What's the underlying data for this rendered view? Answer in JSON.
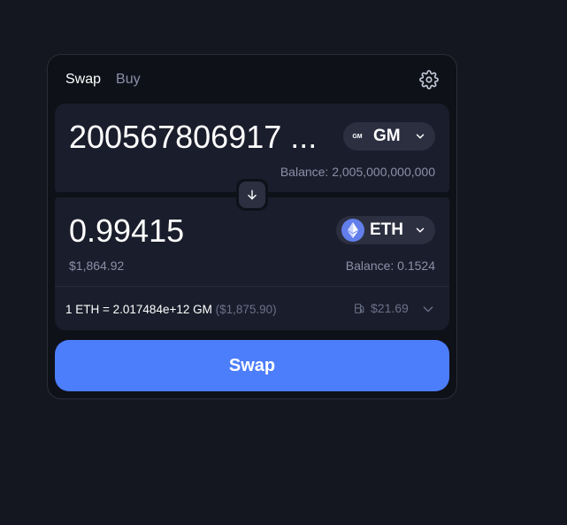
{
  "tabs": [
    {
      "label": "Swap",
      "active": true
    },
    {
      "label": "Buy",
      "active": false
    }
  ],
  "settings_icon": "gear-icon",
  "input": {
    "amount": "200567806917 ...",
    "token": {
      "symbol": "GM",
      "logo_text": "GM"
    },
    "balance": "Balance: 2,005,000,000,000"
  },
  "switch_icon": "arrow-down-icon",
  "output": {
    "amount": "0.99415",
    "usd_value": "$1,864.92",
    "token": {
      "symbol": "ETH",
      "logo_icon": "ethereum-icon"
    },
    "balance": "Balance: 0.1524"
  },
  "rate": {
    "text": "1 ETH = 2.017484e+12 GM",
    "usd": "($1,875.90)"
  },
  "gas": {
    "icon": "gas-pump-icon",
    "value": "$21.69"
  },
  "swap_button": {
    "label": "Swap"
  },
  "colors": {
    "background": "#141620",
    "card": "#0f1119",
    "panel": "#1a1d2b",
    "pill": "#2b2f40",
    "accent": "#4c7dfb",
    "muted_text": "#8a90a8",
    "eth": "#627eea"
  }
}
